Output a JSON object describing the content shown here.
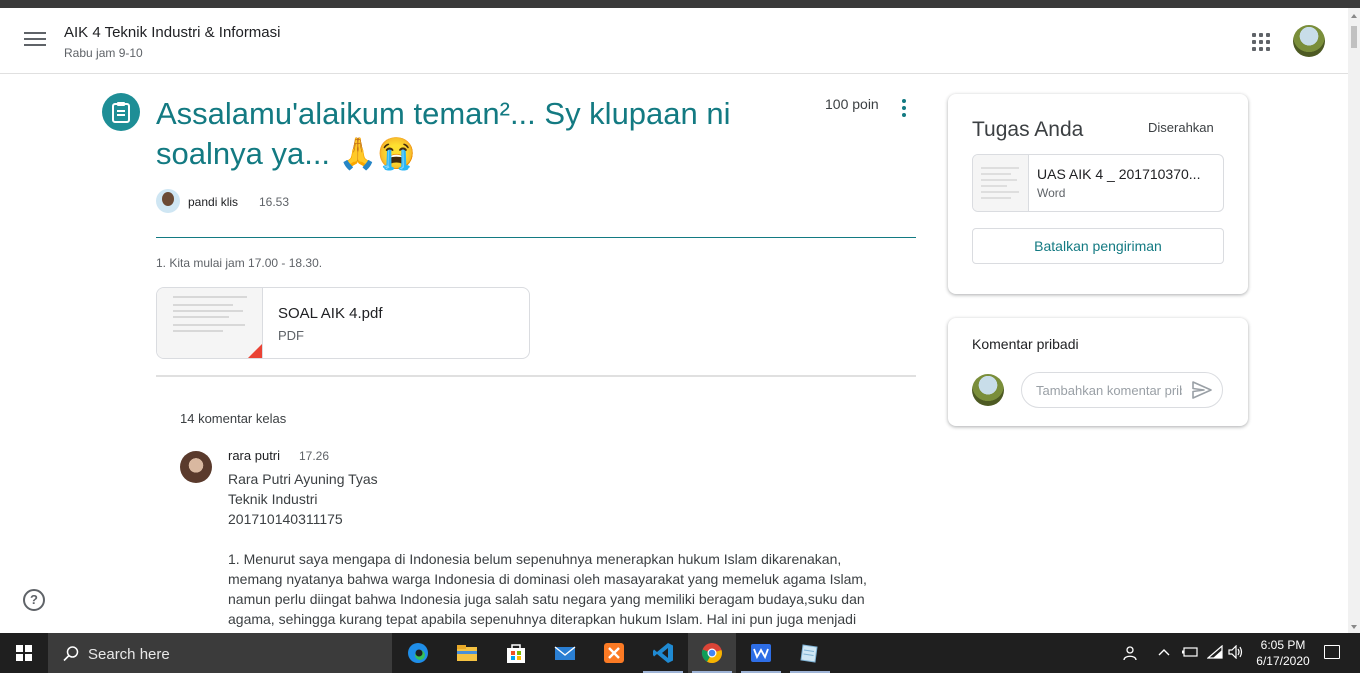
{
  "topbar": {
    "class_title": "AIK 4 Teknik Industri & Informasi",
    "class_subtitle": "Rabu jam 9-10"
  },
  "post": {
    "title": "Assalamu'alaikum teman²... Sy klupaan ni soalnya ya... 🙏😭",
    "points": "100 poin",
    "author": "pandi klis",
    "time": "16.53",
    "instructions": "1. Kita mulai jam 17.00 - 18.30.",
    "attachment": {
      "name": "SOAL AIK 4.pdf",
      "type": "PDF"
    }
  },
  "comments": {
    "count_label": "14 komentar kelas",
    "items": [
      {
        "author": "rara putri",
        "time": "17.26",
        "text": "Rara Putri Ayuning Tyas\nTeknik Industri\n201710140311175\n\n1.     Menurut saya mengapa di Indonesia belum sepenuhnya menerapkan hukum Islam dikarenakan, memang nyatanya bahwa warga Indonesia di dominasi oleh masayarakat yang memeluk agama Islam, namun perlu diingat bahwa Indonesia juga salah satu negara yang memiliki beragam budaya,suku dan agama, sehingga kurang tepat apabila sepenuhnya diterapkan hukum Islam. Hal ini pun juga menjadi"
      }
    ]
  },
  "your_work": {
    "title": "Tugas Anda",
    "status": "Diserahkan",
    "file_name": "UAS AIK 4 _ 201710370...",
    "file_type": "Word",
    "unsubmit_label": "Batalkan pengiriman"
  },
  "private_comments": {
    "title": "Komentar pribadi",
    "placeholder": "Tambahkan komentar pribadi..."
  },
  "taskbar": {
    "search_label": "Search here",
    "time": "6:05 PM",
    "date": "6/17/2020"
  },
  "colors": {
    "accent": "#137a82",
    "icon_bg": "#1e8e96",
    "pdf_red": "#ea4335",
    "taskbar": "#1f1f1f"
  },
  "icons": [
    "menu-icon",
    "apps-icon",
    "assignment-icon",
    "more-vert-icon",
    "send-icon",
    "help-icon",
    "windows-icon",
    "search-icon"
  ]
}
